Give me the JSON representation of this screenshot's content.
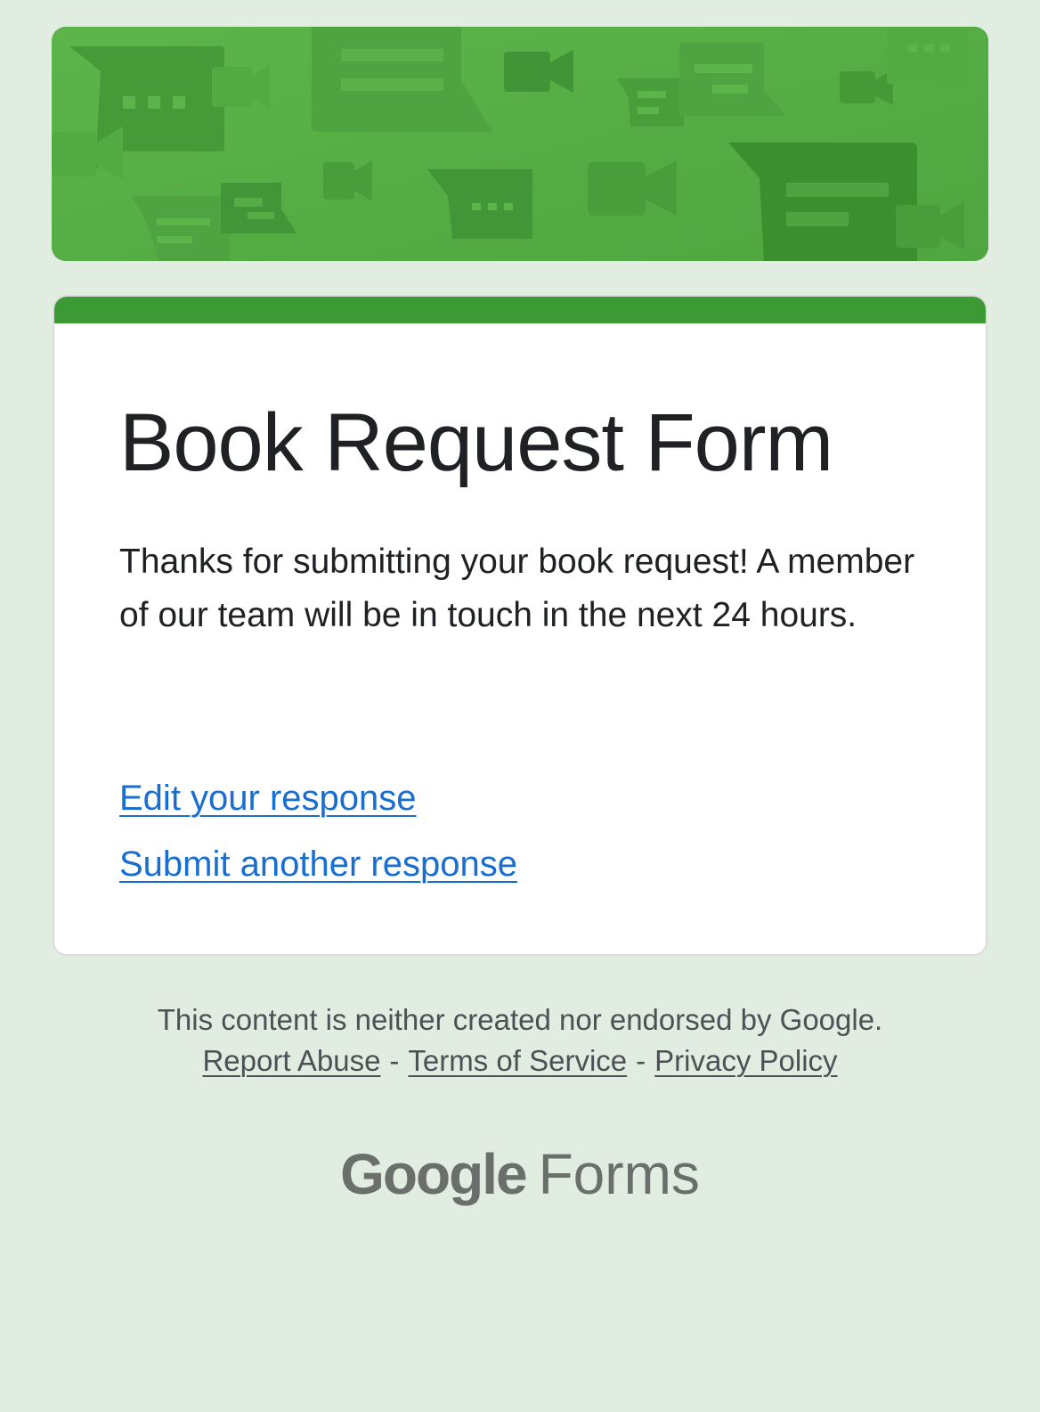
{
  "banner": {
    "icon": "chat-bubbles-and-video-camera-pattern",
    "color": "#56ad45"
  },
  "form": {
    "accent_color": "#3c9a34",
    "title": "Book Request Form",
    "confirmation_message": "Thanks for submitting your book request! A member of our team will be in touch in the next 24 hours.",
    "edit_link": "Edit your response",
    "submit_another_link": "Submit another response"
  },
  "footer": {
    "disclaimer": "This content is neither created nor endorsed by Google.",
    "report_abuse": "Report Abuse",
    "separator": "-",
    "terms": "Terms of Service",
    "privacy": "Privacy Policy",
    "brand_google": "Google",
    "brand_forms": "Forms"
  }
}
